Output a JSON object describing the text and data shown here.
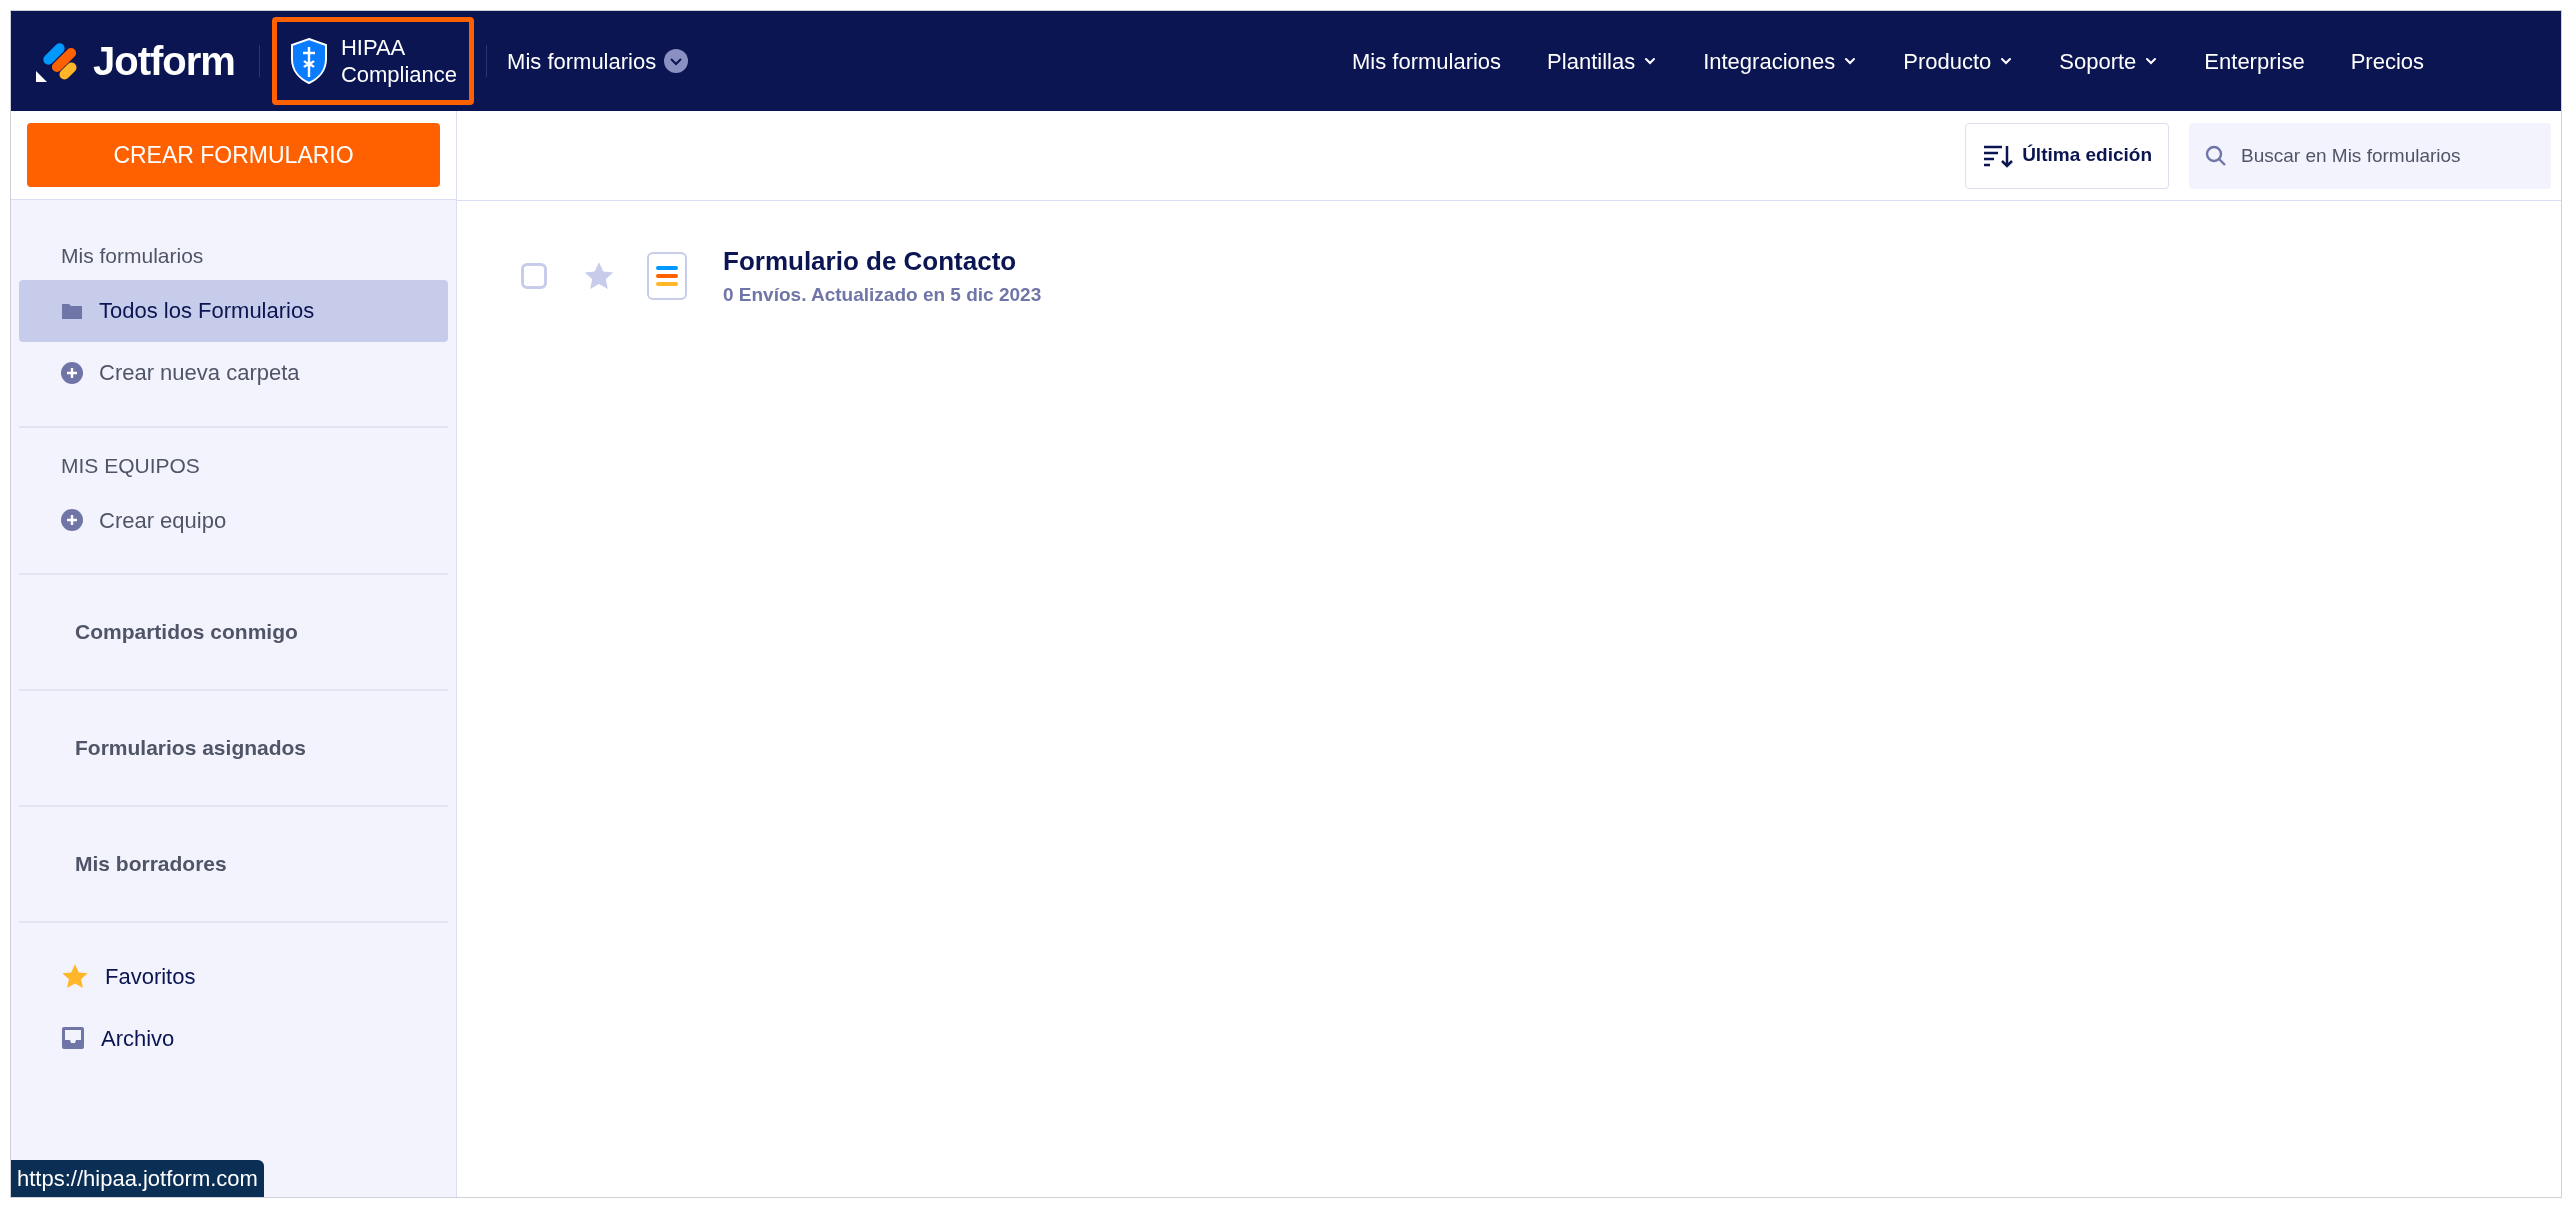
{
  "header": {
    "logo_text": "Jotform",
    "badge_lines": [
      "HIPAA",
      "Compliance"
    ],
    "workspace_menu": "Mis formularios",
    "nav": [
      {
        "label": "Mis formularios",
        "dropdown": false
      },
      {
        "label": "Plantillas",
        "dropdown": true
      },
      {
        "label": "Integraciones",
        "dropdown": true
      },
      {
        "label": "Producto",
        "dropdown": true
      },
      {
        "label": "Soporte",
        "dropdown": true
      },
      {
        "label": "Enterprise",
        "dropdown": false
      },
      {
        "label": "Precios",
        "dropdown": false
      }
    ]
  },
  "sidebar": {
    "create_button": "CREAR FORMULARIO",
    "sections": [
      {
        "kind": "group",
        "heading": "Mis formularios",
        "items": [
          {
            "label": "Todos los Formularios",
            "kind": "folder",
            "selected": true
          },
          {
            "label": "Crear nueva carpeta",
            "kind": "plus",
            "selected": false
          }
        ]
      },
      {
        "kind": "group",
        "heading": "MIS EQUIPOS",
        "items": [
          {
            "label": "Crear equipo",
            "kind": "plus",
            "selected": false
          }
        ]
      },
      {
        "kind": "link",
        "label": "Compartidos conmigo"
      },
      {
        "kind": "link",
        "label": "Formularios asignados"
      },
      {
        "kind": "link",
        "label": "Mis borradores"
      },
      {
        "kind": "group",
        "items": [
          {
            "label": "Favoritos",
            "kind": "star",
            "selected": false
          },
          {
            "label": "Archivo",
            "kind": "inbox",
            "selected": false
          }
        ]
      }
    ]
  },
  "toolbar": {
    "sort_button": "Última edición",
    "search": {
      "placeholder": "Buscar en Mis formularios"
    }
  },
  "forms": [
    {
      "title": "Formulario de Contacto",
      "meta": "0 Envíos. Actualizado en 5 dic 2023",
      "checked": false,
      "starred": false
    }
  ],
  "status_tooltip": "https://hipaa.jotform.com"
}
